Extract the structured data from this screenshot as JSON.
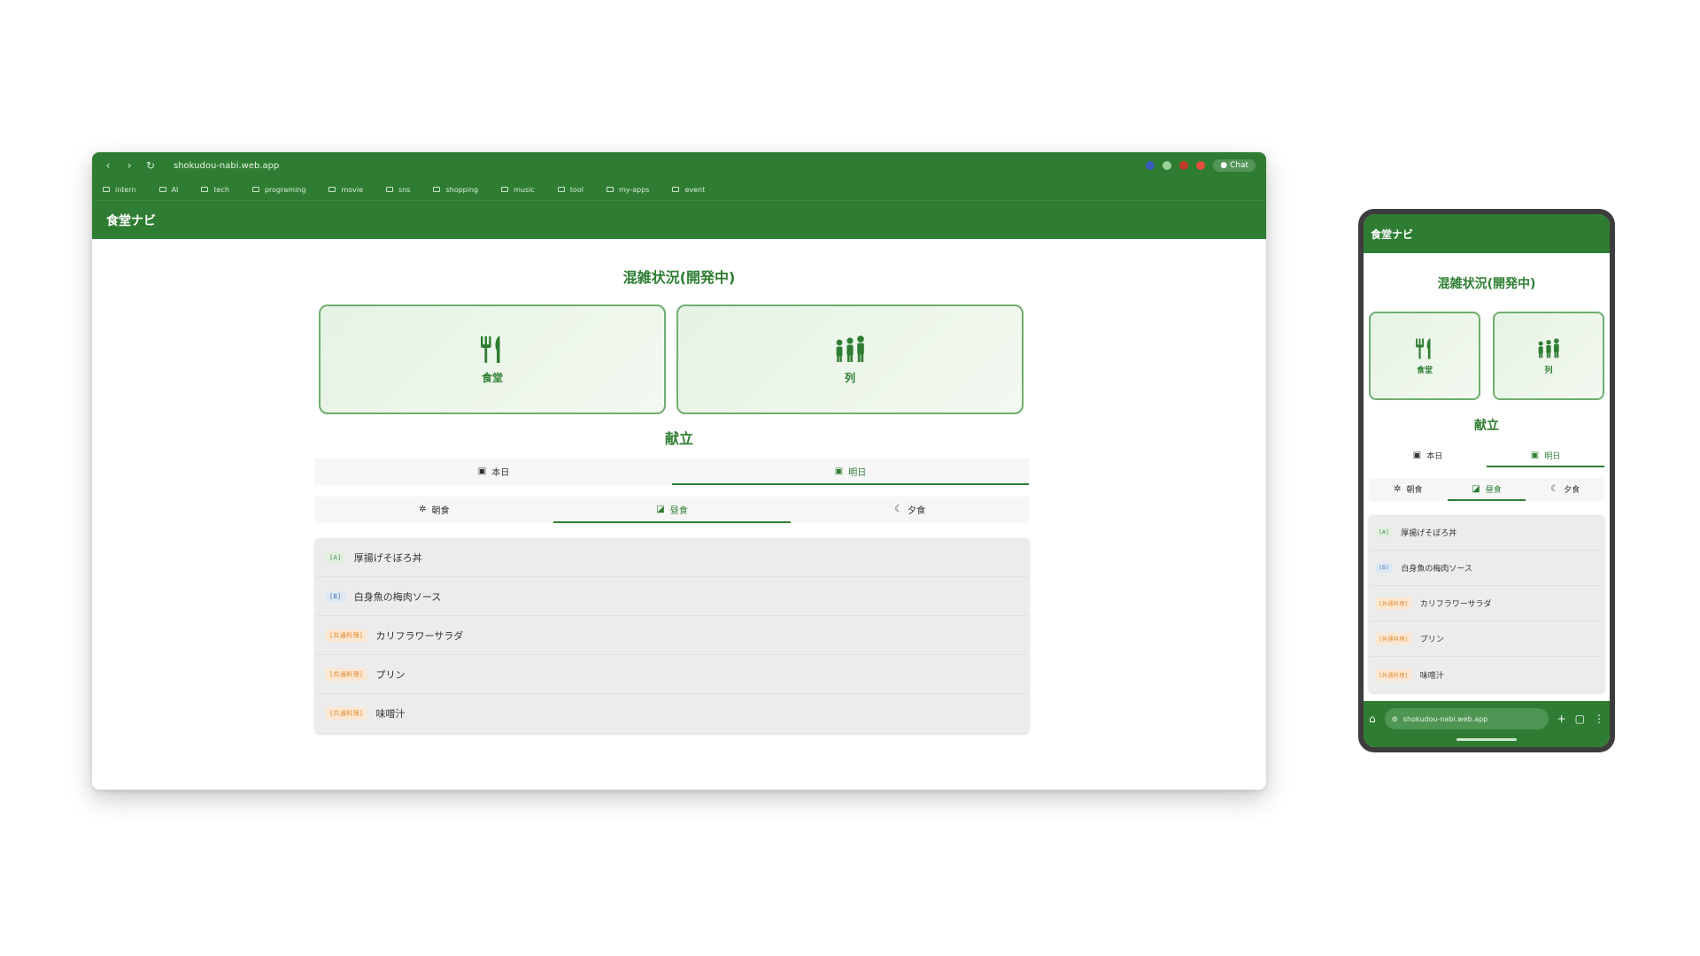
{
  "colors": {
    "brand": "#2e7d32",
    "card_bg": "#eaf5e8",
    "badge_a": "#3f8c4c",
    "badge_b": "#4a78b3",
    "badge_c": "#e08a2c"
  },
  "browser": {
    "url": "shokudou-nabi.web.app",
    "chat_label": "Chat",
    "bookmarks": [
      "intern",
      "AI",
      "tech",
      "programing",
      "movie",
      "sns",
      "shopping",
      "music",
      "tool",
      "my-apps",
      "event"
    ]
  },
  "app": {
    "title": "食堂ナビ",
    "status_title": "混雑状況(開発中)",
    "cards": [
      {
        "label": "食堂",
        "icon": "utensils-icon"
      },
      {
        "label": "列",
        "icon": "people-queue-icon"
      }
    ],
    "menu_title": "献立",
    "day_tabs": [
      {
        "label": "本日",
        "icon": "calendar-icon",
        "active": false
      },
      {
        "label": "明日",
        "icon": "calendar-icon",
        "active": true
      }
    ],
    "meal_tabs": [
      {
        "label": "朝食",
        "icon": "sun-icon",
        "active": false
      },
      {
        "label": "昼食",
        "icon": "lunch-icon",
        "active": true
      },
      {
        "label": "夕食",
        "icon": "moon-icon",
        "active": false
      }
    ],
    "menu_items": [
      {
        "tag": "[A]",
        "name": "厚揚げそぼろ丼"
      },
      {
        "tag": "[B]",
        "name": "白身魚の梅肉ソース"
      },
      {
        "tag": "[共通料理]",
        "name": "カリフラワーサラダ"
      },
      {
        "tag": "[共通料理]",
        "name": "プリン"
      },
      {
        "tag": "[共通料理]",
        "name": "味噌汁"
      }
    ]
  },
  "phone": {
    "url": "shokudou-nabi.web.app"
  }
}
